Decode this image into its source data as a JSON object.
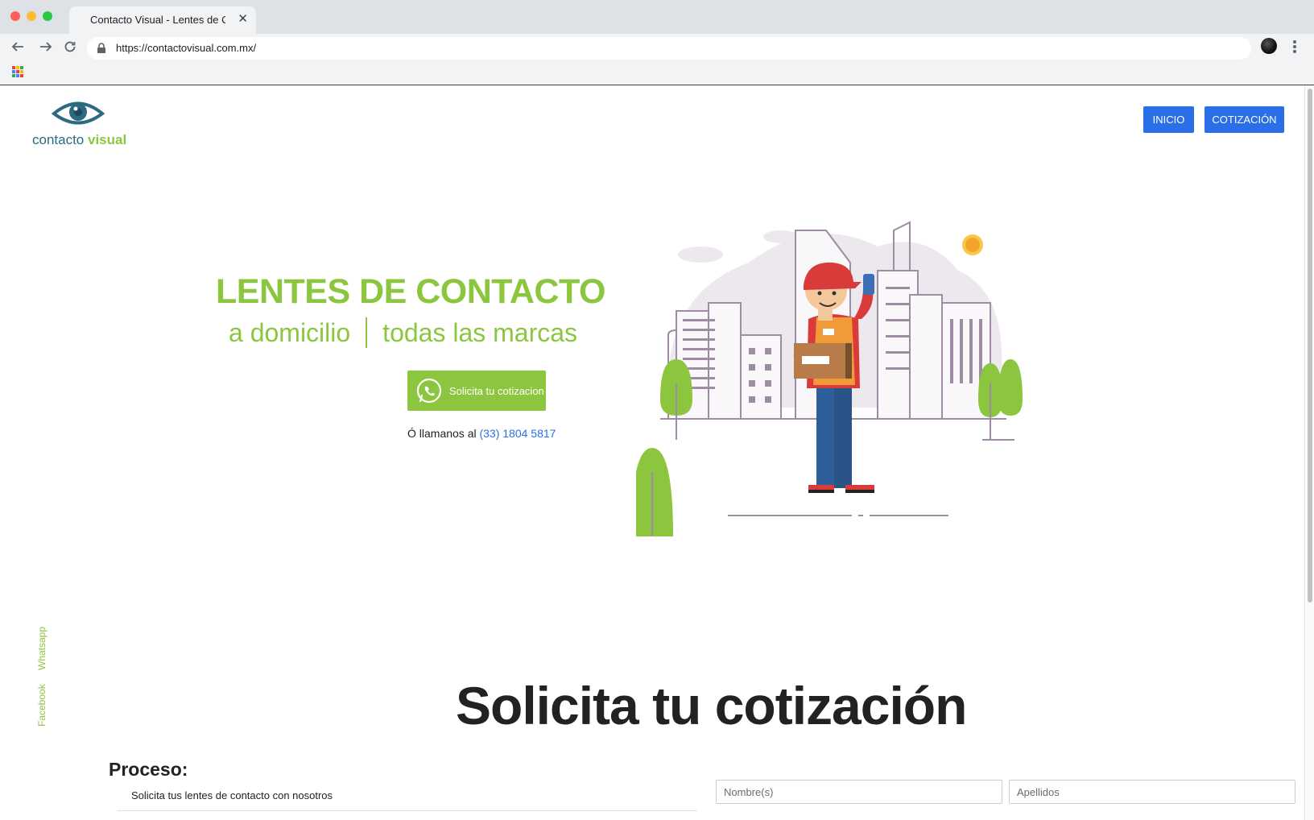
{
  "browser": {
    "tab_title": "Contacto Visual - Lentes de C",
    "tab_close": "✕",
    "url": "https://contactovisual.com.mx/"
  },
  "header": {
    "logo_word1": "contacto",
    "logo_word2": "visual",
    "nav": {
      "inicio": "INICIO",
      "cotizacion": "COTIZACIÓN"
    }
  },
  "hero": {
    "title": "LENTES DE CONTACTO",
    "subtitle_left": "a domicilio",
    "subtitle_right": "todas las marcas",
    "cta_label": "Solicita tu cotizacion",
    "call_prefix": "Ó llamanos al",
    "phone": "(33) 1804 5817"
  },
  "side_links": {
    "whatsapp": "Whatsapp",
    "facebook": "Facebook"
  },
  "quote": {
    "title": "Solicita tu cotización",
    "process_heading": "Proceso:",
    "process_step_1": "Solicita tus lentes de contacto con nosotros",
    "form": {
      "nombre_placeholder": "Nombre(s)",
      "apellidos_placeholder": "Apellidos"
    }
  },
  "colors": {
    "brand_green": "#8cc63f",
    "brand_blue": "#2a6ee8",
    "logo_teal": "#2b6a80"
  },
  "icons": [
    "back-arrow-icon",
    "forward-arrow-icon",
    "reload-icon",
    "lock-icon",
    "apps-grid-icon",
    "whatsapp-icon",
    "eye-logo-icon"
  ]
}
